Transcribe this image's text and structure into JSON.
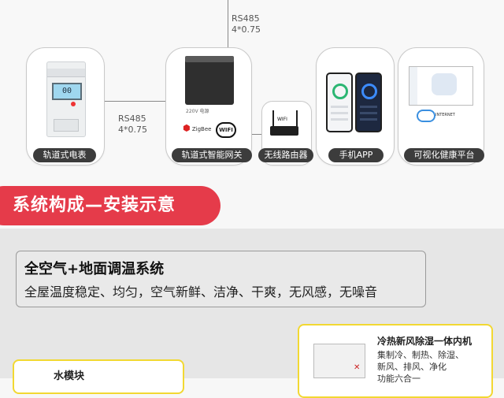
{
  "connections": {
    "top_bus": {
      "protocol": "RS485",
      "spec": "4*0.75"
    },
    "meter_gateway": {
      "protocol": "RS485",
      "spec": "4*0.75"
    }
  },
  "devices": [
    {
      "id": "meter",
      "label": "轨道式电表",
      "screen": "00"
    },
    {
      "id": "gateway",
      "label": "轨道式智能网关",
      "power_caption": "220V 电源",
      "brand_text": "ZigBee",
      "wifi_badge": "WIFI"
    },
    {
      "id": "router",
      "label": "无线路由器",
      "wifi_badge": "WIFI"
    },
    {
      "id": "app",
      "label": "手机APP"
    },
    {
      "id": "platform",
      "label": "可视化健康平台",
      "cloud_text": "INTERNET"
    }
  ],
  "banner": {
    "title": "系统构成—安装示意"
  },
  "system": {
    "title": "全空气+地面调温系统",
    "subtitle": "全屋温度稳定、均匀，空气新鲜、洁净、干爽，无风感，无噪音"
  },
  "water_module": {
    "title": "水模块"
  },
  "indoor_unit": {
    "title": "冷热新风除湿一体内机",
    "features": [
      "集制冷、制热、除湿、",
      "新风、排风、净化",
      "功能六合一"
    ]
  },
  "colors": {
    "accent": "#e53b4a",
    "label_bg": "#3c3c3c",
    "highlight_border": "#f2d832"
  }
}
